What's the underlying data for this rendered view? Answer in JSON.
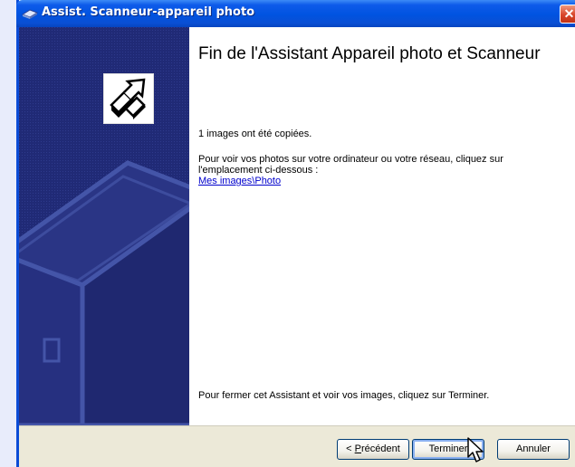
{
  "window": {
    "title": "Assist. Scanneur-appareil photo",
    "close_label": "✕"
  },
  "content": {
    "heading": "Fin de l'Assistant Appareil photo et Scanneur",
    "copied_text": "1 images ont été copiées.",
    "instruction_line1": "Pour voir vos photos sur votre ordinateur ou votre réseau, cliquez sur",
    "instruction_line2": "l'emplacement ci-dessous :",
    "location_link": "Mes images\\Photo",
    "finish_text": "Pour fermer cet Assistant et voir vos images, cliquez sur Terminer."
  },
  "buttons": {
    "back_prefix": "< ",
    "back_accel": "P",
    "back_rest": "récédent",
    "finish": "Terminer",
    "cancel": "Annuler"
  },
  "colors": {
    "titlebar": "#0053e0",
    "left_panel": "#202a76",
    "footer": "#ece9d8",
    "link": "#0000cc"
  },
  "icons": {
    "title": "scanner-camera-icon",
    "wizard": "transfer-arrows-icon",
    "cursor": "mouse-pointer-icon"
  }
}
